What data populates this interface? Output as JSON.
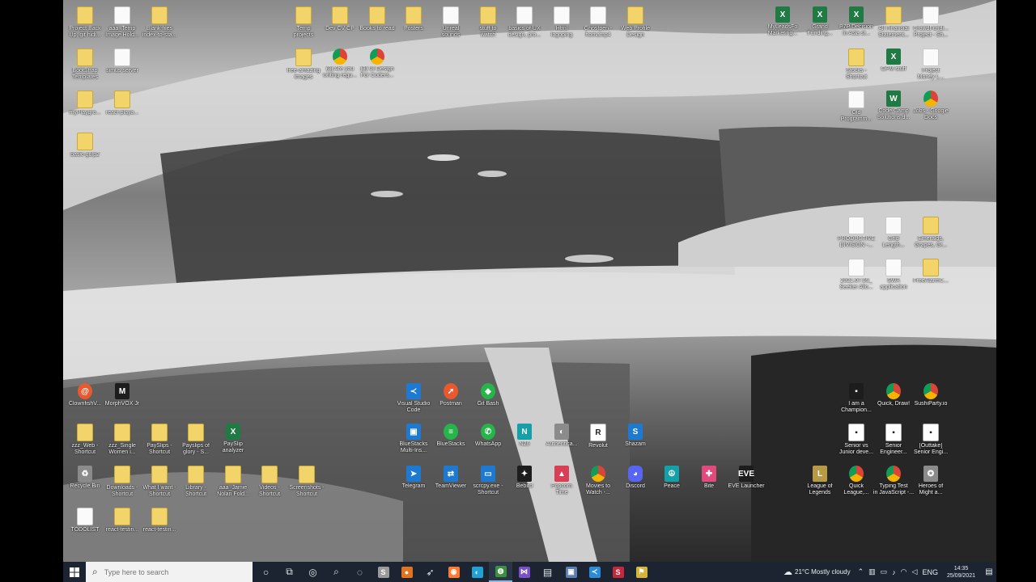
{
  "desktop_icons": [
    {
      "label": "Project Back\nUp, git hidi...",
      "type": "folder",
      "glyph": ""
    },
    {
      "label": "aaa_Temp\nImage Hold...",
      "type": "file",
      "glyph": ""
    },
    {
      "label": "Blank-files\nindex-to-sta...",
      "type": "folder",
      "glyph": ""
    },
    {
      "label": "BootStrap\nTemplates",
      "type": "folder",
      "glyph": ""
    },
    {
      "label": "simus server",
      "type": "file",
      "glyph": ""
    },
    {
      "label": "myPlaygro...",
      "type": "folder",
      "glyph": ""
    },
    {
      "label": "react-playa...",
      "type": "folder",
      "glyph": ""
    },
    {
      "label": "basic-gulp2",
      "type": "folder",
      "glyph": ""
    },
    {
      "label": "Temp\nprojects",
      "type": "folder",
      "glyph": ""
    },
    {
      "label": "Dev CV CP",
      "type": "folder",
      "glyph": ""
    },
    {
      "label": "Books to read",
      "type": "folder",
      "glyph": ""
    },
    {
      "label": "Posters",
      "type": "folder",
      "glyph": ""
    },
    {
      "label": "Unreal\nsounds",
      "type": "file",
      "glyph": ""
    },
    {
      "label": "stuff to\nwatch",
      "type": "folder",
      "glyph": ""
    },
    {
      "label": "basics of UX\ndesign, pro...",
      "type": "file",
      "glyph": ""
    },
    {
      "label": "Html\nlogoping",
      "type": "file",
      "glyph": ""
    },
    {
      "label": "Ghostpen -\nhomamp4",
      "type": "file",
      "glyph": ""
    },
    {
      "label": "Web Profile\nDesign",
      "type": "folder",
      "glyph": ""
    },
    {
      "label": "free-amazing\nimages",
      "type": "folder",
      "glyph": ""
    },
    {
      "label": "(3) Are you\nwriting regu...",
      "type": "chrome",
      "glyph": ""
    },
    {
      "label": "(3) UI Design\nFor Coders...",
      "type": "chrome",
      "glyph": ""
    },
    {
      "label": "MyLeadsFo\nMarketing...",
      "type": "excel",
      "glyph": "X"
    },
    {
      "label": "Grand\nFunding...",
      "type": "excel",
      "glyph": "X"
    },
    {
      "label": "P7P Decision\nIn Asia st...",
      "type": "excel",
      "glyph": "X"
    },
    {
      "label": "All Financial\nStatement...",
      "type": "folder",
      "glyph": ""
    },
    {
      "label": "CrowdFundi...\nProject - Sh...",
      "type": "file",
      "glyph": ""
    },
    {
      "label": "Stocks -\nShortcut",
      "type": "folder",
      "glyph": ""
    },
    {
      "label": "OPM stuff",
      "type": "excel",
      "glyph": "X"
    },
    {
      "label": "Project\nMoney L...",
      "type": "file",
      "glyph": ""
    },
    {
      "label": "Old\nProgramm...",
      "type": "file",
      "glyph": ""
    },
    {
      "label": "Code Camp\nSolutions.d...",
      "type": "excel",
      "glyph": "W"
    },
    {
      "label": "Jobs - Google\nDocs",
      "type": "chrome",
      "glyph": ""
    },
    {
      "label": "PRODUCTIVE\nDIVISION -...",
      "type": "file",
      "glyph": ""
    },
    {
      "label": "Grid\nLength...",
      "type": "file",
      "glyph": ""
    },
    {
      "label": "Emeralds,\nGrapes, Gr...",
      "type": "folder",
      "glyph": ""
    },
    {
      "label": "2021.07.09_\nSeeker Allo...",
      "type": "file",
      "glyph": ""
    },
    {
      "label": "SWA\napplication",
      "type": "file",
      "glyph": ""
    },
    {
      "label": "FreeAlarmC...",
      "type": "folder",
      "glyph": ""
    },
    {
      "label": "ClownfishV...",
      "type": "orange",
      "glyph": "@"
    },
    {
      "label": "MorphVOX Jr",
      "type": "dark",
      "glyph": "M"
    },
    {
      "label": "Visual Studio\nCode",
      "type": "blue",
      "glyph": "≺"
    },
    {
      "label": "Postman",
      "type": "orange",
      "glyph": "➚"
    },
    {
      "label": "Git Bash",
      "type": "green",
      "glyph": "◆"
    },
    {
      "label": "zzz_Web -\nShortcut",
      "type": "folder",
      "glyph": ""
    },
    {
      "label": "zzz_Single\nWomen i...",
      "type": "folder",
      "glyph": ""
    },
    {
      "label": "PaySlips -\nShortcut",
      "type": "folder",
      "glyph": ""
    },
    {
      "label": "Payslips of\nglory - S...",
      "type": "folder",
      "glyph": ""
    },
    {
      "label": "PaySlip\nanalyzer",
      "type": "excel",
      "glyph": "X"
    },
    {
      "label": "BlueStacks\nMulti-Ins...",
      "type": "blue",
      "glyph": "▣"
    },
    {
      "label": "BlueStacks",
      "type": "green",
      "glyph": "≡"
    },
    {
      "label": "WhatsApp",
      "type": "green",
      "glyph": "✆"
    },
    {
      "label": "N26",
      "type": "teal",
      "glyph": "N"
    },
    {
      "label": "Authentica...",
      "type": "gray",
      "glyph": "◐"
    },
    {
      "label": "Revolut",
      "type": "white",
      "glyph": "R"
    },
    {
      "label": "Shazam",
      "type": "blue",
      "glyph": "S"
    },
    {
      "label": "Recycle Bin",
      "type": "gray",
      "glyph": "♻"
    },
    {
      "label": "Downloads -\nShortcut",
      "type": "folder",
      "glyph": ""
    },
    {
      "label": "What I want -\nShortcut",
      "type": "folder",
      "glyph": ""
    },
    {
      "label": "Library -\nShortcut",
      "type": "folder",
      "glyph": ""
    },
    {
      "label": "aaa_Jamie\nNolan Fold...",
      "type": "folder",
      "glyph": ""
    },
    {
      "label": "Videos -\nShortcut",
      "type": "folder",
      "glyph": ""
    },
    {
      "label": "Screenshots -\nShortcut",
      "type": "folder",
      "glyph": ""
    },
    {
      "label": "Telegram",
      "type": "blue",
      "glyph": "➤"
    },
    {
      "label": "TeamViewer",
      "type": "blue",
      "glyph": "⇄"
    },
    {
      "label": "scrcpy.exe -\nShortcut",
      "type": "blue",
      "glyph": "▭"
    },
    {
      "label": "Bebird",
      "type": "dark",
      "glyph": "✦"
    },
    {
      "label": "Popcorn\nTime",
      "type": "red",
      "glyph": "▲"
    },
    {
      "label": "Movies to\nWatch -...",
      "type": "chrome",
      "glyph": ""
    },
    {
      "label": "Discord",
      "type": "purple",
      "glyph": "◕"
    },
    {
      "label": "Peace",
      "type": "teal",
      "glyph": "☮"
    },
    {
      "label": "Bite",
      "type": "pink",
      "glyph": "✚"
    },
    {
      "label": "EVE Launcher",
      "type": "dark",
      "glyph": "EVE"
    },
    {
      "label": "TODOLIST",
      "type": "file",
      "glyph": ""
    },
    {
      "label": "react-testin...",
      "type": "folder",
      "glyph": ""
    },
    {
      "label": "react-testin...",
      "type": "folder",
      "glyph": ""
    },
    {
      "label": "I am a\nChampion...",
      "type": "dark",
      "glyph": "▪"
    },
    {
      "label": "Quick, Draw!",
      "type": "chrome",
      "glyph": ""
    },
    {
      "label": "SushiParty.io",
      "type": "chrome",
      "glyph": ""
    },
    {
      "label": "Senior vs\nJunior deve...",
      "type": "white",
      "glyph": "▪"
    },
    {
      "label": "Senior\nEngineer...",
      "type": "white",
      "glyph": "▪"
    },
    {
      "label": "[Outtake]\nSenior Engi...",
      "type": "white",
      "glyph": "▪"
    },
    {
      "label": "League of\nLegends",
      "type": "gold",
      "glyph": "L"
    },
    {
      "label": "Quick\nLeague,...",
      "type": "chrome",
      "glyph": ""
    },
    {
      "label": "Typing Test\nin JavaScript -...",
      "type": "chrome",
      "glyph": ""
    },
    {
      "label": "Heroes of\nMight a...",
      "type": "gray",
      "glyph": "✪"
    }
  ],
  "taskbar": {
    "search_placeholder": "Type here to search",
    "weather_temp": "21°C",
    "weather_desc": "Mostly cloudy",
    "language": "ENG",
    "time": "14:35",
    "date": "25/09/2021",
    "apps": [
      {
        "name": "cortana",
        "glyph": "○",
        "active": false
      },
      {
        "name": "task-view",
        "glyph": "⧉",
        "active": false
      },
      {
        "name": "app-circle",
        "glyph": "◎",
        "active": false
      },
      {
        "name": "app-search",
        "glyph": "⌕",
        "active": false
      },
      {
        "name": "app-chat",
        "glyph": "◌",
        "active": false
      },
      {
        "name": "app-s",
        "glyph": "S",
        "active": false
      },
      {
        "name": "app-orange",
        "glyph": "●",
        "active": false
      },
      {
        "name": "app-feather",
        "glyph": "➶",
        "active": false
      },
      {
        "name": "firefox",
        "glyph": "◉",
        "active": false
      },
      {
        "name": "edge",
        "glyph": "◐",
        "active": false
      },
      {
        "name": "chrome",
        "glyph": "◍",
        "active": true
      },
      {
        "name": "visual-studio",
        "glyph": "⋈",
        "active": false
      },
      {
        "name": "terminal",
        "glyph": "▤",
        "active": false
      },
      {
        "name": "window-app",
        "glyph": "▣",
        "active": false
      },
      {
        "name": "vscode",
        "glyph": "≺",
        "active": false
      },
      {
        "name": "app-red",
        "glyph": "S",
        "active": false
      },
      {
        "name": "app-flag",
        "glyph": "⚑",
        "active": false
      }
    ]
  }
}
